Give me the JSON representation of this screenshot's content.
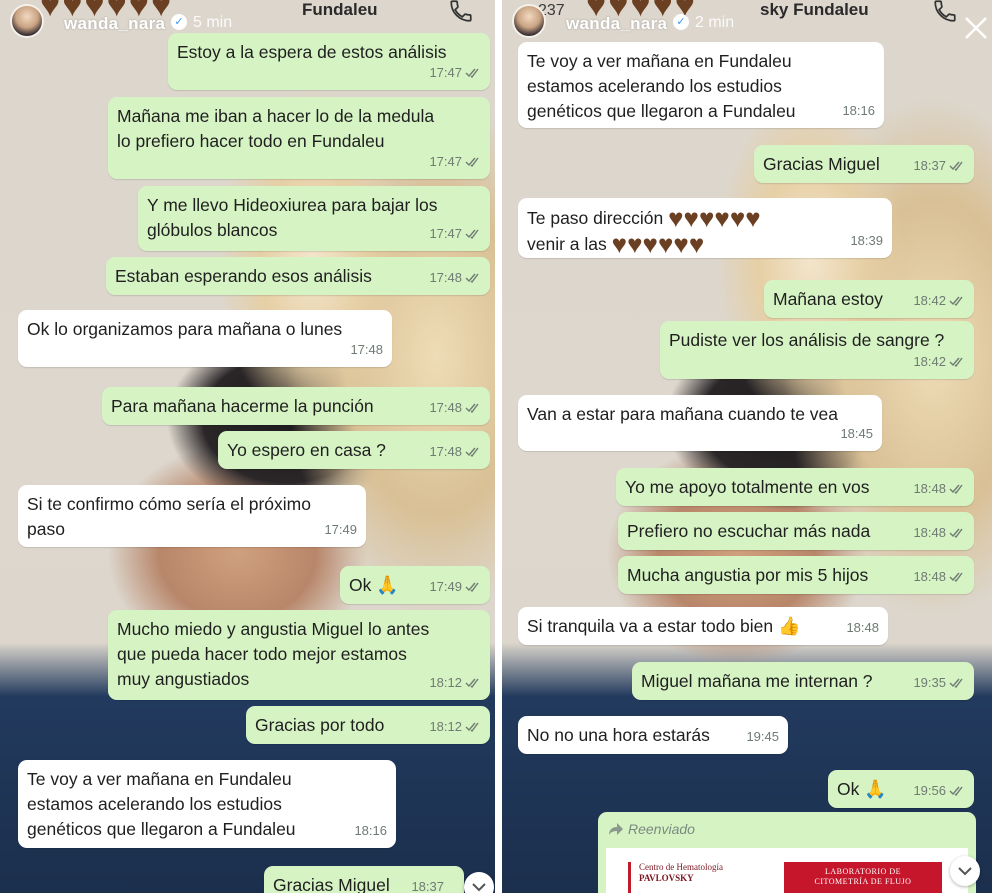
{
  "left": {
    "header": {
      "username": "wanda_nara",
      "verified_symbol": "✓",
      "time_ago": "5 min",
      "chat_name": "Fundaleu"
    },
    "messages": [
      {
        "type": "sent",
        "text": "Estoy a la espera de estos análisis",
        "time": "17:47"
      },
      {
        "type": "sent",
        "text": "Mañana me iban a hacer lo de la medula\nlo prefiero hacer todo en Fundaleu",
        "time": "17:47"
      },
      {
        "type": "sent",
        "text": "Y me llevo Hideoxiurea para bajar los\nglóbulos blancos",
        "time": "17:47"
      },
      {
        "type": "sent",
        "text": "Estaban esperando esos análisis",
        "time": "17:48"
      },
      {
        "type": "recv",
        "text": "Ok lo organizamos para mañana o lunes",
        "time": "17:48"
      },
      {
        "type": "sent",
        "text": "Para mañana hacerme la punción",
        "time": "17:48"
      },
      {
        "type": "sent",
        "text": "Yo espero en casa ?",
        "time": "17:48"
      },
      {
        "type": "recv",
        "text": "Si te confirmo cómo sería el próximo\npaso",
        "time": "17:49"
      },
      {
        "type": "sent",
        "text": "Ok",
        "emoji": "🙏",
        "time": "17:49"
      },
      {
        "type": "sent",
        "text": "Mucho miedo y angustia Miguel lo antes\nque pueda hacer todo mejor estamos\nmuy angustiados",
        "time": "18:12"
      },
      {
        "type": "sent",
        "text": "Gracias por todo",
        "time": "18:12"
      },
      {
        "type": "recv",
        "text": "Te voy a ver mañana en Fundaleu\nestamos acelerando los estudios\ngenéticos que llegaron a Fundaleu",
        "time": "18:16"
      },
      {
        "type": "sent",
        "text": "Gracias Miguel",
        "time": "18:37"
      }
    ]
  },
  "right": {
    "header": {
      "prefix": "237",
      "username": "wanda_nara",
      "verified_symbol": "✓",
      "time_ago": "2 min",
      "chat_name": "sky Fundaleu"
    },
    "messages": [
      {
        "type": "recv",
        "text": "Te voy a ver mañana en Fundaleu\nestamos acelerando los estudios\ngenéticos que llegaron a Fundaleu",
        "time": "18:16"
      },
      {
        "type": "sent",
        "text": "Gracias Miguel",
        "time": "18:37"
      },
      {
        "type": "recv",
        "text_line1": "Te paso dirección",
        "text_line2": "venir a las",
        "time": "18:39"
      },
      {
        "type": "sent",
        "text": "Mañana estoy",
        "time": "18:42"
      },
      {
        "type": "sent",
        "text": "Pudiste ver los análisis de sangre ?",
        "time": "18:42"
      },
      {
        "type": "recv",
        "text": "Van a estar para mañana cuando te vea",
        "time": "18:45"
      },
      {
        "type": "sent",
        "text": "Yo me apoyo totalmente en vos",
        "time": "18:48"
      },
      {
        "type": "sent",
        "text": "Prefiero no escuchar más nada",
        "time": "18:48"
      },
      {
        "type": "sent",
        "text": "Mucha angustia por mis 5 hijos",
        "time": "18:48"
      },
      {
        "type": "recv",
        "text": "Si tranquila va a estar todo bien",
        "emoji": "👍",
        "time": "18:48"
      },
      {
        "type": "sent",
        "text": "Miguel mañana me internan ?",
        "time": "19:35"
      },
      {
        "type": "recv",
        "text": "No no una hora estarás",
        "time": "19:45"
      },
      {
        "type": "sent",
        "text": "Ok",
        "emoji": "🙏",
        "time": "19:56"
      }
    ],
    "forwarded": {
      "label": "Reenviado",
      "doc_logo_line1": "Centro de Hematología",
      "doc_logo_line2": "PAVLOVSKY",
      "doc_red_line1": "LABORATORIO DE",
      "doc_red_line2": "CITOMETRÍA DE FLUJO"
    }
  },
  "colors": {
    "sent_bubble": "#d6f3c4",
    "received_bubble": "#ffffff",
    "heart_emoji": "#6b3f22"
  }
}
